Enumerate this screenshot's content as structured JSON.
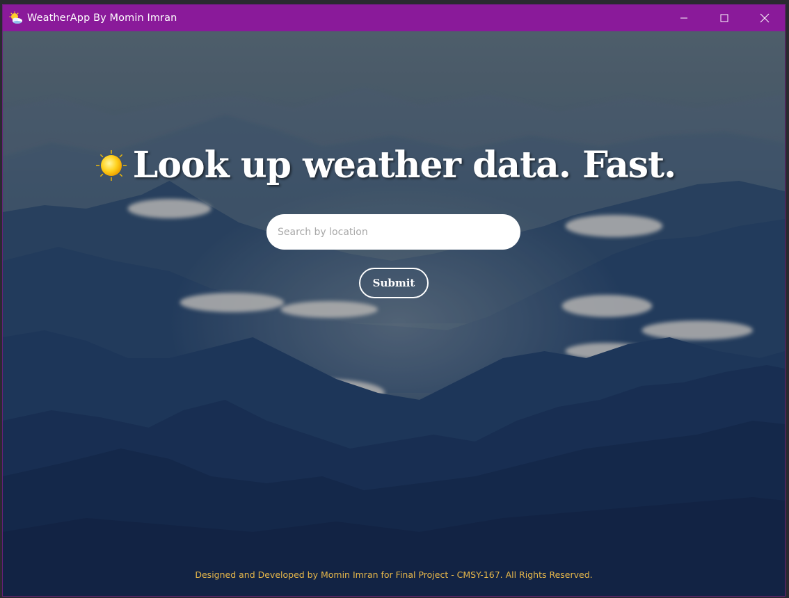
{
  "window": {
    "title": "WeatherApp By Momin Imran",
    "app_icon": "weather-icon",
    "controls": [
      "minimize-icon",
      "maximize-icon",
      "close-icon"
    ]
  },
  "main": {
    "headline": "Look up weather data. Fast.",
    "headline_icon": "sun-icon",
    "search": {
      "value": "",
      "placeholder": "Search by location"
    },
    "submit_label": "Submit"
  },
  "footer": {
    "text": "Designed and Developed by Momin Imran for Final Project - CMSY-167. All Rights Reserved."
  },
  "colors": {
    "titlebar": "#8a1a9a",
    "footer_text": "#e8b84a",
    "headline_text": "#ffffff"
  }
}
